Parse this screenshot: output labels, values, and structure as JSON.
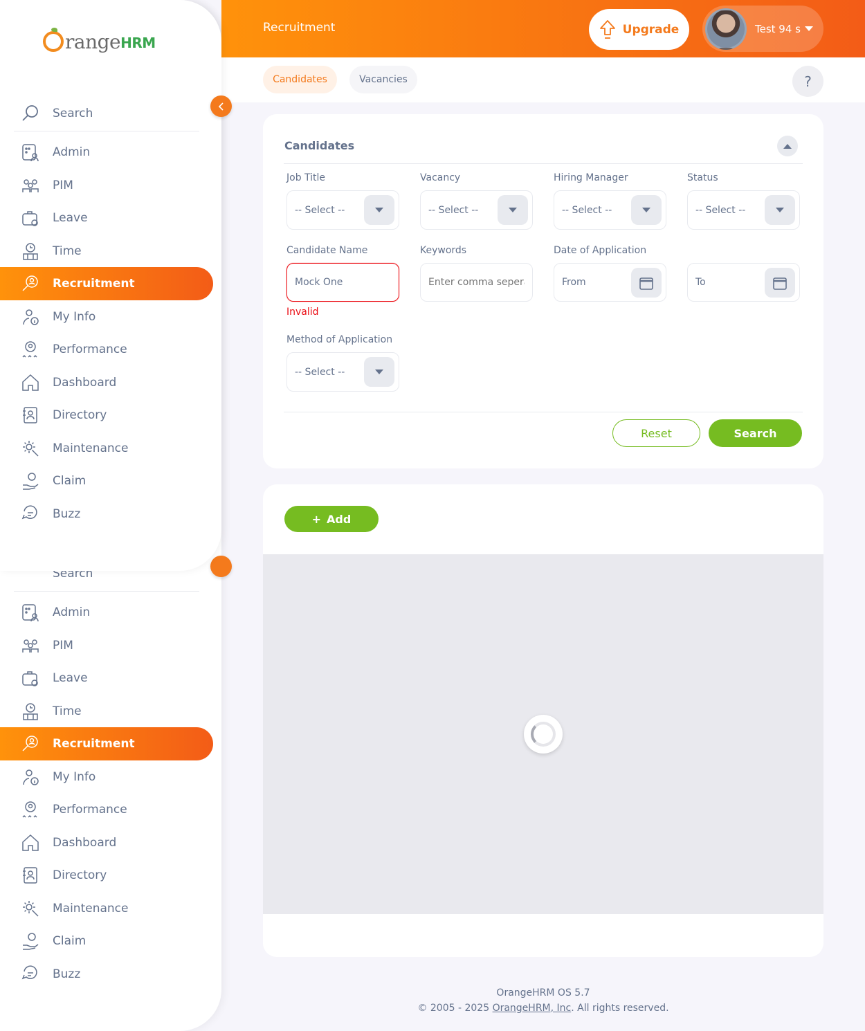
{
  "app": {
    "brand_text_main": "range",
    "brand_text_suffix": "HRM"
  },
  "header": {
    "title": "Recruitment",
    "upgrade_label": "Upgrade",
    "user_name": "Test 94 s"
  },
  "sidebar": {
    "search_label": "Search",
    "items": [
      {
        "label": "Admin",
        "icon": "admin-icon",
        "active": false
      },
      {
        "label": "PIM",
        "icon": "pim-icon",
        "active": false
      },
      {
        "label": "Leave",
        "icon": "leave-icon",
        "active": false
      },
      {
        "label": "Time",
        "icon": "time-icon",
        "active": false
      },
      {
        "label": "Recruitment",
        "icon": "recruitment-icon",
        "active": true
      },
      {
        "label": "My Info",
        "icon": "my-info-icon",
        "active": false
      },
      {
        "label": "Performance",
        "icon": "performance-icon",
        "active": false
      },
      {
        "label": "Dashboard",
        "icon": "dashboard-icon",
        "active": false
      },
      {
        "label": "Directory",
        "icon": "directory-icon",
        "active": false
      },
      {
        "label": "Maintenance",
        "icon": "maintenance-icon",
        "active": false
      },
      {
        "label": "Claim",
        "icon": "claim-icon",
        "active": false
      },
      {
        "label": "Buzz",
        "icon": "buzz-icon",
        "active": false
      }
    ]
  },
  "subnav": {
    "tabs": [
      {
        "label": "Candidates",
        "active": true
      },
      {
        "label": "Vacancies",
        "active": false
      }
    ],
    "help_label": "?"
  },
  "filter": {
    "title": "Candidates",
    "job_title": {
      "label": "Job Title",
      "value": "-- Select --"
    },
    "vacancy": {
      "label": "Vacancy",
      "value": "-- Select --"
    },
    "hiring_manager": {
      "label": "Hiring Manager",
      "value": "-- Select --"
    },
    "status": {
      "label": "Status",
      "value": "-- Select --"
    },
    "candidate_name": {
      "label": "Candidate Name",
      "value": "Mock One",
      "error": "Invalid"
    },
    "keywords": {
      "label": "Keywords",
      "placeholder": "Enter comma seperated words..."
    },
    "date_of_application": {
      "label": "Date of Application",
      "from_placeholder": "From",
      "to_placeholder": "To"
    },
    "method_of_application": {
      "label": "Method of Application",
      "value": "-- Select --"
    },
    "reset_label": "Reset",
    "search_label": "Search"
  },
  "results": {
    "add_label": "Add"
  },
  "footer": {
    "version": "OrangeHRM OS 5.7",
    "copyright_prefix": "© 2005 - 2025 ",
    "company_link": "OrangeHRM, Inc",
    "copyright_suffix": ". All rights reserved."
  },
  "colors": {
    "accent": "#f47a1c",
    "primary_green": "#76bc21",
    "error": "#eb0910",
    "text": "#64728c"
  }
}
